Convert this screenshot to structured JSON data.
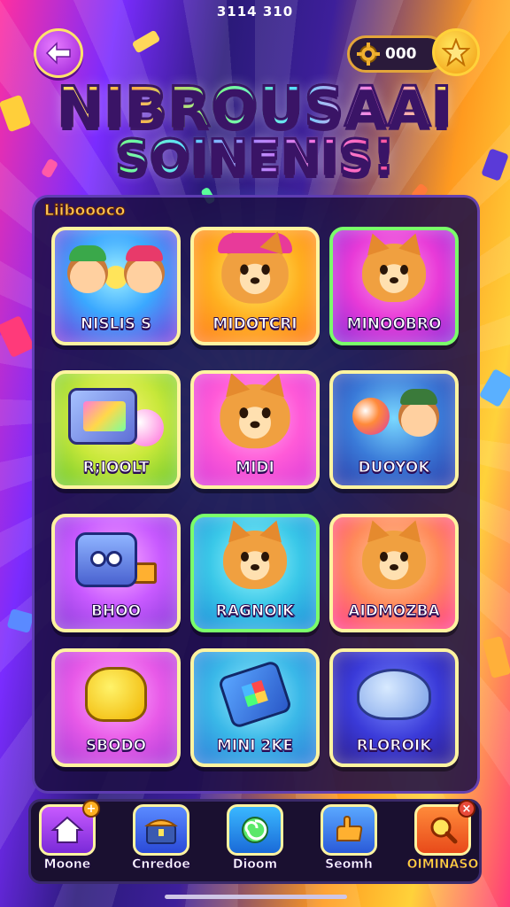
{
  "status": {
    "time": "3114 310"
  },
  "header": {
    "back_icon": "arrow-left-icon",
    "coins_icon": "gear-icon",
    "coins": "000",
    "star_icon": "star-icon"
  },
  "title": {
    "line1": "NIBROUSAAI",
    "line2": "SOINENIS!"
  },
  "panel": {
    "label": "Liiboooco"
  },
  "games": [
    {
      "label": "NISLIS S"
    },
    {
      "label": "MIDOTCRI"
    },
    {
      "label": "MINOOBRO"
    },
    {
      "label": "R;IOOLT"
    },
    {
      "label": "MIDI"
    },
    {
      "label": "DUOYOK"
    },
    {
      "label": "BHOO"
    },
    {
      "label": "RAGNOIK"
    },
    {
      "label": "AIDMOZBA"
    },
    {
      "label": "SBODO"
    },
    {
      "label": "MINI 2KE"
    },
    {
      "label": "RLOROIK"
    }
  ],
  "nav": [
    {
      "label": "Moone",
      "icon": "home-icon"
    },
    {
      "label": "Cnredoe",
      "icon": "chest-icon"
    },
    {
      "label": "Dioom",
      "icon": "swirl-icon"
    },
    {
      "label": "Seomh",
      "icon": "hand-icon"
    },
    {
      "label": "OIMINASO",
      "icon": "search-icon"
    }
  ],
  "colors": {
    "accent": "#ffd23a",
    "panel": "#1c0e46"
  }
}
